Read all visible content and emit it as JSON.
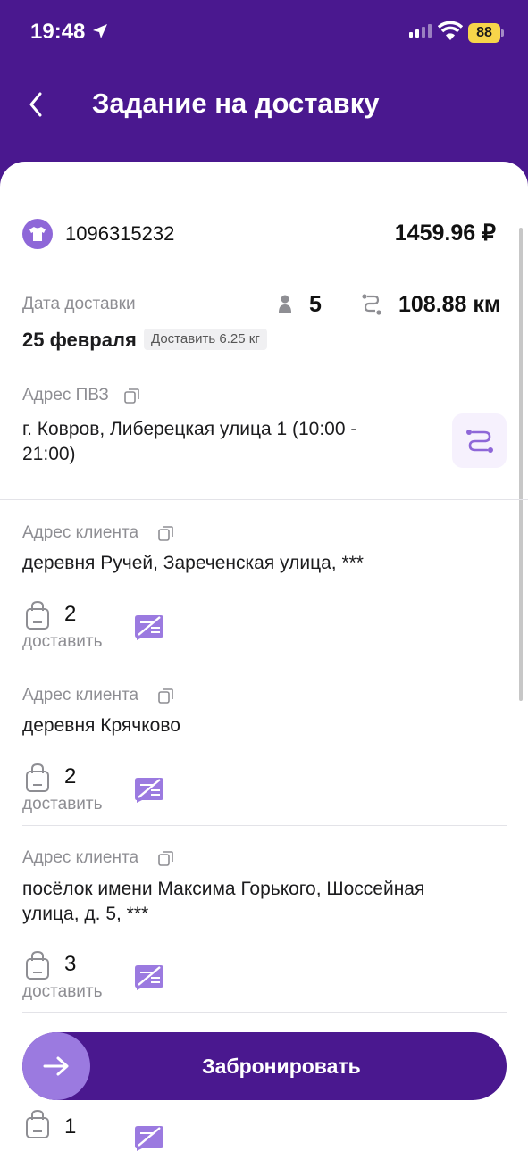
{
  "status_bar": {
    "time": "19:48",
    "battery": "88"
  },
  "header": {
    "title": "Задание на доставку"
  },
  "order": {
    "id": "1096315232",
    "price": "1459.96 ₽"
  },
  "delivery": {
    "date_label": "Дата доставки",
    "date_value": "25 февраля",
    "weight_badge": "Доставить 6.25 кг",
    "points_count": "5",
    "distance": "108.88 км"
  },
  "pickup": {
    "label": "Адрес ПВЗ",
    "address_line1": "г. Ковров, Либерецкая улица 1 (10:00 -",
    "address_line2": "21:00)"
  },
  "clients": [
    {
      "label": "Адрес клиента",
      "address_line1": "деревня Ручей, Зареченская улица, ***",
      "address_line2": "",
      "count": "2",
      "action": "доставить"
    },
    {
      "label": "Адрес клиента",
      "address_line1": "деревня Крячково",
      "address_line2": "",
      "count": "2",
      "action": "доставить"
    },
    {
      "label": "Адрес клиента",
      "address_line1": "посёлок имени Максима Горького, Шоссейная",
      "address_line2": "улица, д. 5, ***",
      "count": "3",
      "action": "доставить"
    },
    {
      "label": "",
      "address_line1": "",
      "address_line2": "",
      "count": "1",
      "action": ""
    }
  ],
  "book_button": {
    "label": "Забронировать"
  },
  "colors": {
    "header": "#4a188f",
    "accent": "#8e67d8",
    "button_circle": "#9b7ae0"
  }
}
